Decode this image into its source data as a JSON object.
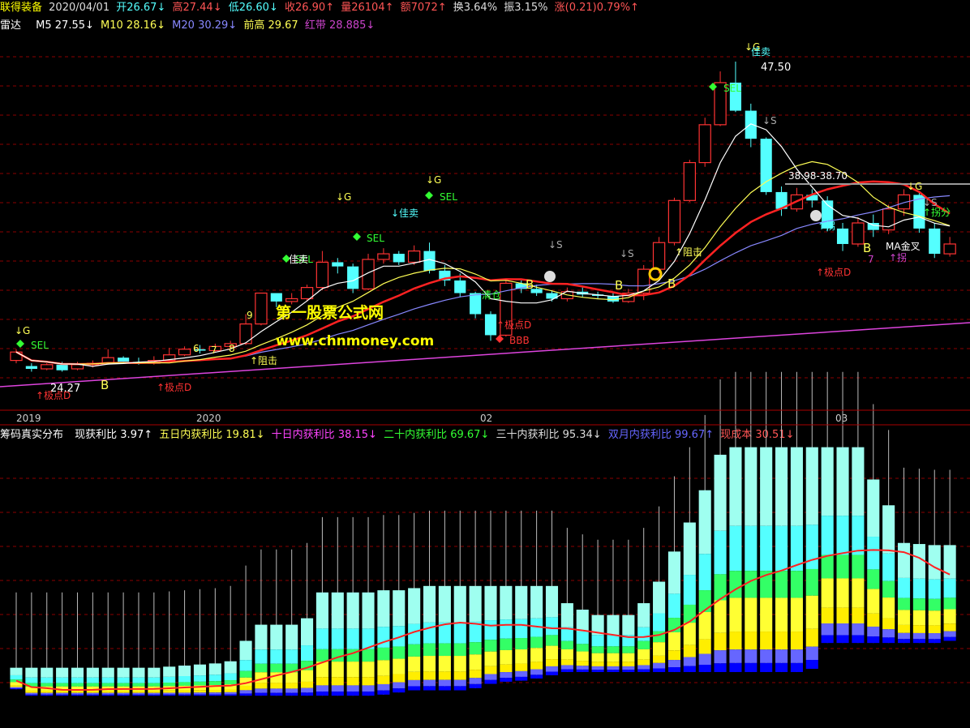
{
  "header": {
    "stock_name": "联得装备",
    "date": "2020/04/01",
    "open": "开26.67↓",
    "high": "高27.44↓",
    "low": "低26.60↓",
    "close": "收26.90↑",
    "volume": "量26104↑",
    "amount": "额7072↑",
    "turnover": "换3.64%",
    "amplitude": "振3.15%",
    "change": "涨(0.21)0.79%↑"
  },
  "indicator1": {
    "name": "雷达",
    "m5": "M5 27.55↓",
    "m10": "M10 28.16↓",
    "m20": "M20 30.29↓",
    "prev_high": "前高 29.67",
    "red_band": "红带 28.885↓"
  },
  "indicator2": {
    "name": "筹码真实分布",
    "profit_now": "现获利比 3.97↑",
    "profit_5d": "五日内获利比 19.81↓",
    "profit_10d": "十日内获利比 38.15↓",
    "profit_20d": "二十内获利比 69.67↓",
    "profit_30d": "三十内获利比 95.34↓",
    "profit_2m": "双月内获利比 99.67↑",
    "cost_now": "现成本 30.51↓"
  },
  "watermark": {
    "line1": "第一股票公式网",
    "line2": "www.chnmoney.com"
  },
  "annotations": {
    "price_high": "47.50",
    "price_low": "24.27",
    "range_label": "38.98-38.70",
    "sel": "SEL",
    "g": "↓G",
    "s": "↓S",
    "b": "B",
    "good_sell": "佳卖",
    "low_point": "↑极点D",
    "bbb": "BBB",
    "clear": "清仓",
    "block": "↑阻击",
    "ma_cross": "MA金叉",
    "n6": "6",
    "n7": "7",
    "n8": "8",
    "n9": "9",
    "jian": "↓佳卖",
    "jian2": "↑拐",
    "yong": "↑拐分"
  },
  "colors": {
    "up": "#ff3333",
    "down": "#54ffff",
    "ma5": "#ffffff",
    "ma10": "#ffff55",
    "ma20": "#8888ff",
    "band": "#ff2222",
    "band_green": "#22dd22",
    "trend": "#dd44dd",
    "grid": "#8b0000"
  },
  "chart_data": {
    "type": "candlestick",
    "x_ticks": [
      "2019",
      "2020",
      "02",
      "03"
    ],
    "ylim": [
      23,
      49
    ],
    "candles": [
      [
        26.2,
        26.8,
        26.0,
        27.0
      ],
      [
        25.8,
        25.6,
        25.4,
        26.0
      ],
      [
        25.6,
        25.9,
        25.5,
        26.0
      ],
      [
        25.9,
        25.5,
        25.4,
        26.1
      ],
      [
        25.6,
        25.9,
        25.5,
        26.1
      ],
      [
        25.9,
        26.0,
        25.7,
        26.2
      ],
      [
        26.0,
        26.4,
        25.9,
        27.0
      ],
      [
        26.4,
        26.1,
        26.0,
        26.5
      ],
      [
        26.1,
        26.0,
        25.9,
        26.4
      ],
      [
        26.0,
        26.2,
        25.9,
        26.5
      ],
      [
        26.2,
        26.6,
        26.1,
        27.1
      ],
      [
        26.6,
        27.0,
        26.5,
        27.2
      ],
      [
        27.0,
        26.9,
        26.7,
        27.3
      ],
      [
        26.9,
        27.2,
        26.8,
        27.4
      ],
      [
        27.2,
        27.4,
        27.0,
        27.6
      ],
      [
        27.4,
        28.8,
        27.3,
        29.5
      ],
      [
        28.8,
        31.0,
        28.7,
        31.0
      ],
      [
        31.0,
        30.4,
        30.0,
        30.8
      ],
      [
        30.4,
        30.6,
        30.2,
        31.0
      ],
      [
        30.6,
        31.4,
        30.4,
        31.6
      ],
      [
        31.4,
        33.2,
        31.2,
        34.0
      ],
      [
        33.2,
        32.9,
        32.4,
        33.5
      ],
      [
        32.9,
        31.3,
        31.0,
        33.1
      ],
      [
        31.3,
        33.4,
        31.2,
        33.8
      ],
      [
        33.4,
        33.8,
        33.1,
        34.2
      ],
      [
        33.8,
        33.2,
        33.0,
        34.0
      ],
      [
        33.2,
        34.0,
        33.0,
        34.4
      ],
      [
        34.0,
        32.6,
        32.4,
        34.6
      ],
      [
        32.6,
        31.9,
        31.5,
        33.0
      ],
      [
        31.9,
        31.0,
        30.7,
        32.4
      ],
      [
        31.0,
        29.5,
        29.2,
        31.1
      ],
      [
        29.5,
        28.0,
        27.6,
        29.7
      ],
      [
        28.0,
        31.7,
        27.9,
        31.9
      ],
      [
        31.7,
        31.3,
        31.0,
        31.9
      ],
      [
        31.3,
        31.0,
        30.8,
        31.6
      ],
      [
        31.0,
        30.6,
        30.4,
        31.2
      ],
      [
        30.6,
        31.1,
        30.4,
        31.4
      ],
      [
        31.1,
        30.9,
        30.7,
        31.4
      ],
      [
        30.9,
        30.8,
        30.6,
        31.1
      ],
      [
        30.8,
        30.4,
        30.3,
        31.0
      ],
      [
        30.4,
        31.0,
        30.3,
        31.3
      ],
      [
        31.0,
        32.7,
        30.5,
        33.0
      ],
      [
        32.7,
        34.6,
        32.4,
        35.0
      ],
      [
        34.6,
        37.6,
        34.4,
        37.8
      ],
      [
        37.6,
        40.3,
        37.5,
        40.5
      ],
      [
        40.3,
        43.0,
        40.0,
        43.5
      ],
      [
        43.0,
        46.0,
        42.9,
        46.8
      ],
      [
        46.0,
        44.0,
        43.9,
        47.5
      ],
      [
        44.0,
        42.0,
        41.4,
        44.5
      ],
      [
        42.0,
        38.2,
        38.0,
        42.1
      ],
      [
        38.2,
        37.0,
        36.5,
        38.6
      ],
      [
        37.0,
        38.0,
        36.8,
        38.5
      ],
      [
        38.0,
        37.6,
        37.1,
        38.4
      ],
      [
        37.6,
        35.6,
        35.4,
        37.9
      ],
      [
        35.6,
        34.5,
        34.0,
        36.0
      ],
      [
        34.5,
        36.0,
        34.3,
        36.4
      ],
      [
        36.0,
        35.5,
        35.0,
        36.6
      ],
      [
        35.5,
        37.0,
        35.2,
        37.3
      ],
      [
        37.0,
        38.0,
        36.5,
        38.4
      ],
      [
        38.0,
        35.6,
        35.3,
        38.2
      ],
      [
        35.6,
        33.8,
        33.5,
        36.0
      ],
      [
        33.8,
        34.5,
        33.6,
        35.0
      ]
    ],
    "ma5_label": "M5",
    "ma10_label": "M10",
    "ma20_label": "M20"
  }
}
